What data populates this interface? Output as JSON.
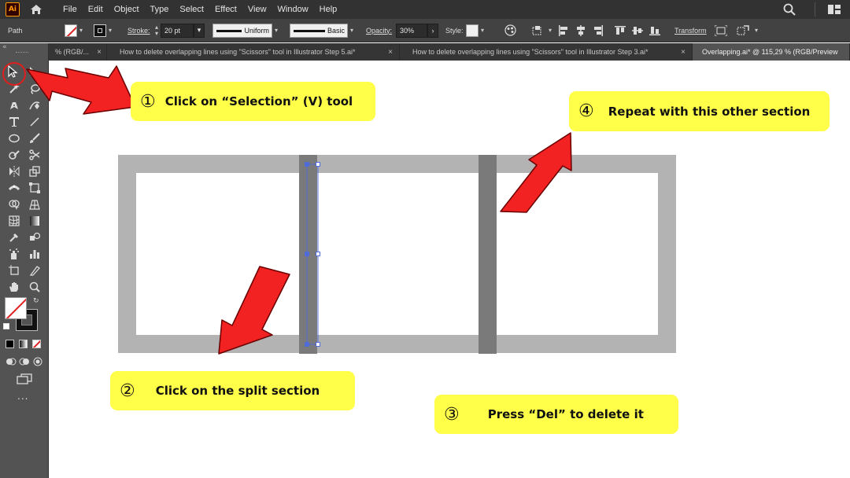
{
  "app": {
    "logo": "Ai"
  },
  "menu": [
    "File",
    "Edit",
    "Object",
    "Type",
    "Select",
    "Effect",
    "View",
    "Window",
    "Help"
  ],
  "control": {
    "object_type": "Path",
    "stroke_label": "Stroke:",
    "stroke_weight": "20 pt",
    "variable_width_profile": "Uniform",
    "brush": "Basic",
    "opacity_label": "Opacity:",
    "opacity_value": "30%",
    "style_label": "Style:",
    "transform_label": "Transform"
  },
  "tabs": [
    {
      "label": "% (RGB/..."
    },
    {
      "label": "How to delete overlapping lines using \"Scissors\" tool in Illustrator Step 5.ai*"
    },
    {
      "label": "How to delete overlapping lines using \"Scissors\" tool in Illustrator Step 3.ai*"
    },
    {
      "label": "Overlapping.ai* @ 115,29 % (RGB/Preview"
    }
  ],
  "toolbar": {
    "more_label": "..."
  },
  "callouts": [
    {
      "num": "①",
      "text": "Click on “Selection” (V) tool"
    },
    {
      "num": "②",
      "text": "Click on the split section"
    },
    {
      "num": "③",
      "text": "Press “Del” to delete it"
    },
    {
      "num": "④",
      "text": "Repeat with this other section"
    }
  ],
  "colors": {
    "callout_bg": "#ffff4a",
    "arrow": "#f22222",
    "artwork_gray": "#b3b3b3",
    "divider_dark": "#7a7a7a",
    "selection_blue": "#4f6bd8"
  }
}
